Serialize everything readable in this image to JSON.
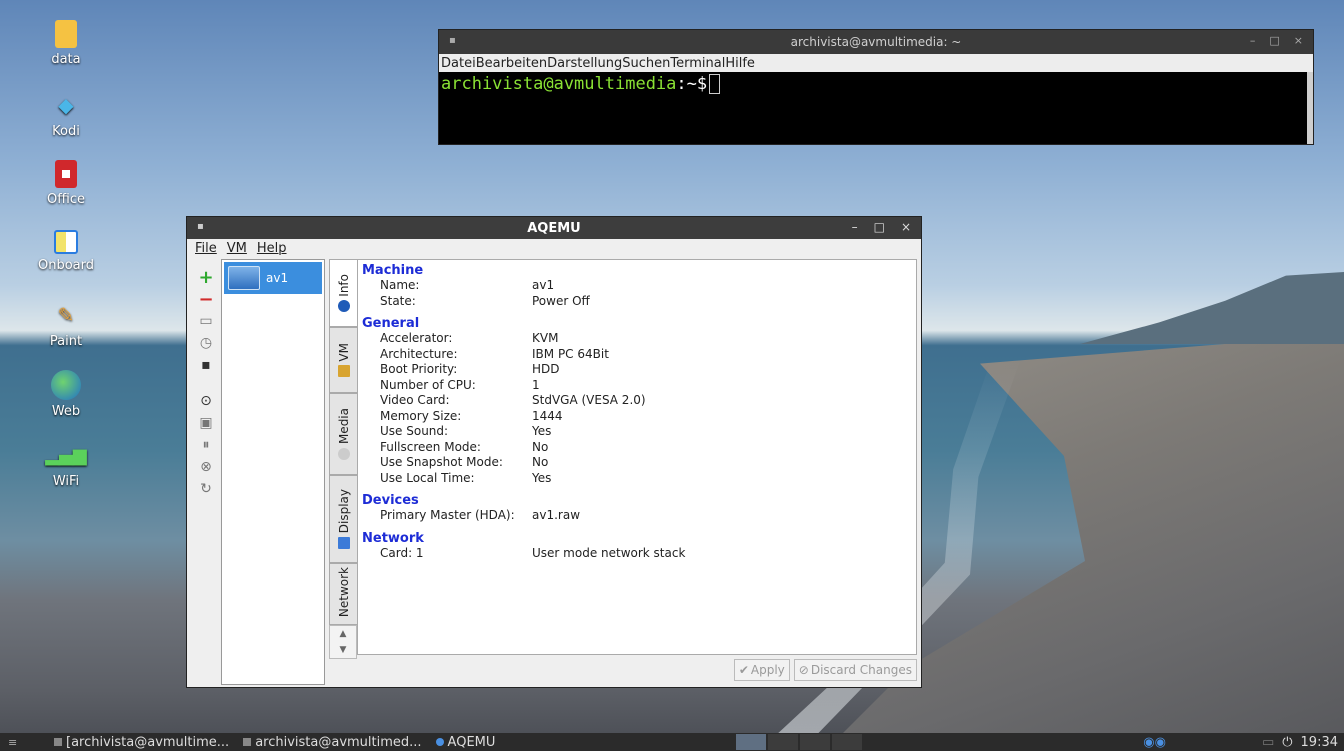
{
  "desktop": {
    "icons": [
      {
        "label": "data",
        "icon": "folder-icon"
      },
      {
        "label": "Kodi",
        "icon": "kodi-icon"
      },
      {
        "label": "Office",
        "icon": "office-icon"
      },
      {
        "label": "Onboard",
        "icon": "onboard-icon"
      },
      {
        "label": "Paint",
        "icon": "paint-icon"
      },
      {
        "label": "Web",
        "icon": "globe-icon"
      },
      {
        "label": "WiFi",
        "icon": "wifi-icon"
      }
    ]
  },
  "terminal": {
    "title": "archivista@avmultimedia: ~",
    "menu": [
      "Datei",
      "Bearbeiten",
      "Darstellung",
      "Suchen",
      "Terminal",
      "Hilfe"
    ],
    "prompt_user": "archivista@avmultimedia",
    "prompt_sep": ":~$",
    "min_glyph": "–",
    "max_glyph": "□",
    "close_glyph": "×"
  },
  "aqemu": {
    "title": "AQEMU",
    "menu": [
      "File",
      "VM",
      "Help"
    ],
    "vm_list": [
      {
        "name": "av1"
      }
    ],
    "tabs": [
      "Info",
      "VM",
      "Media",
      "Display",
      "Network"
    ],
    "sections": [
      {
        "title": "Machine",
        "rows": [
          [
            "Name:",
            "av1"
          ],
          [
            "State:",
            "Power Off"
          ]
        ]
      },
      {
        "title": "General",
        "rows": [
          [
            "Accelerator:",
            "KVM"
          ],
          [
            "Architecture:",
            "IBM PC 64Bit"
          ],
          [
            "Boot Priority:",
            "HDD"
          ],
          [
            "Number of CPU:",
            "1"
          ],
          [
            "Video Card:",
            "StdVGA (VESA 2.0)"
          ],
          [
            "Memory Size:",
            "1444"
          ],
          [
            "Use Sound:",
            "Yes"
          ],
          [
            "Fullscreen Mode:",
            "No"
          ],
          [
            "Use Snapshot Mode:",
            "No"
          ],
          [
            "Use Local Time:",
            "Yes"
          ]
        ]
      },
      {
        "title": "Devices",
        "rows": [
          [
            "Primary Master (HDA):",
            "av1.raw"
          ]
        ]
      },
      {
        "title": "Network",
        "rows": [
          [
            "Card: 1",
            "User mode network stack"
          ]
        ]
      }
    ],
    "apply_label": "Apply",
    "discard_label": "Discard Changes"
  },
  "taskbar": {
    "tasks": [
      {
        "label": "[archivista@avmultime...",
        "active": false
      },
      {
        "label": "archivista@avmultimed...",
        "active": false
      },
      {
        "label": "AQEMU",
        "active": true
      }
    ],
    "clock": "19:34"
  },
  "colors": {
    "accent": "#3b8ede",
    "section_title": "#1d2cd6",
    "prompt": "#8ae234"
  }
}
